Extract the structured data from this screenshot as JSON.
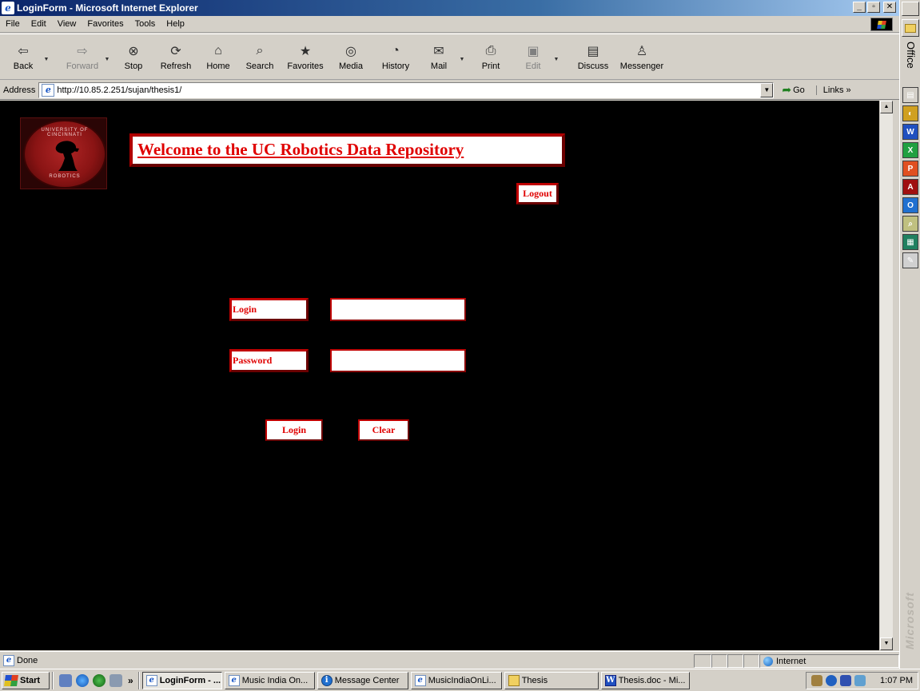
{
  "window": {
    "title": "LoginForm - Microsoft Internet Explorer",
    "controls": {
      "minimize": "_",
      "maximize": "▫",
      "close": "✕"
    }
  },
  "menu": [
    "File",
    "Edit",
    "View",
    "Favorites",
    "Tools",
    "Help"
  ],
  "toolbar": [
    {
      "label": "Back",
      "icon": "back-arrow-icon",
      "glyph": "⇦",
      "dropdown": true,
      "disabled": false
    },
    {
      "label": "Forward",
      "icon": "forward-arrow-icon",
      "glyph": "⇨",
      "dropdown": true,
      "disabled": true
    },
    {
      "label": "Stop",
      "icon": "stop-icon",
      "glyph": "⊗",
      "dropdown": false,
      "disabled": false
    },
    {
      "label": "Refresh",
      "icon": "refresh-icon",
      "glyph": "⟳",
      "dropdown": false,
      "disabled": false
    },
    {
      "label": "Home",
      "icon": "home-icon",
      "glyph": "⌂",
      "dropdown": false,
      "disabled": false
    },
    {
      "label": "Search",
      "icon": "search-icon",
      "glyph": "⌕",
      "dropdown": false,
      "disabled": false
    },
    {
      "label": "Favorites",
      "icon": "favorites-icon",
      "glyph": "★",
      "dropdown": false,
      "disabled": false
    },
    {
      "label": "Media",
      "icon": "media-icon",
      "glyph": "◎",
      "dropdown": false,
      "disabled": false
    },
    {
      "label": "History",
      "icon": "history-icon",
      "glyph": "◔",
      "dropdown": false,
      "disabled": false
    },
    {
      "label": "Mail",
      "icon": "mail-icon",
      "glyph": "✉",
      "dropdown": true,
      "disabled": false
    },
    {
      "label": "Print",
      "icon": "print-icon",
      "glyph": "⎙",
      "dropdown": false,
      "disabled": false
    },
    {
      "label": "Edit",
      "icon": "edit-icon",
      "glyph": "▣",
      "dropdown": true,
      "disabled": true
    },
    {
      "label": "Discuss",
      "icon": "discuss-icon",
      "glyph": "▤",
      "dropdown": false,
      "disabled": false
    },
    {
      "label": "Messenger",
      "icon": "messenger-icon",
      "glyph": "♙",
      "dropdown": false,
      "disabled": false
    }
  ],
  "address": {
    "label": "Address",
    "url": "http://10.85.2.251/sujan/thesis1/",
    "go_label": "Go",
    "links_label": "Links »"
  },
  "page": {
    "logo_text_top": "UNIVERSITY OF CINCINNATI",
    "logo_text_bottom": "ROBOTICS",
    "welcome": "Welcome to the UC Robotics Data Repository",
    "logout": "Logout",
    "login_label": "Login",
    "password_label": "Password",
    "login_value": "",
    "password_value": "",
    "login_button": "Login",
    "clear_button": "Clear"
  },
  "status": {
    "text": "Done",
    "zone": "Internet"
  },
  "taskbar": {
    "start": "Start",
    "chevron": "»",
    "tasks": [
      {
        "label": "LoginForm - ...",
        "icon": "ie",
        "active": true,
        "width": 100
      },
      {
        "label": "Music India On...",
        "icon": "ie",
        "active": false,
        "width": 113
      },
      {
        "label": "Message Center",
        "icon": "msg",
        "active": false,
        "width": 114
      },
      {
        "label": "MusicIndiaOnLi...",
        "icon": "ie",
        "active": false,
        "width": 114
      },
      {
        "label": "Thesis",
        "icon": "folder",
        "active": false,
        "width": 118
      },
      {
        "label": "Thesis.doc - Mi...",
        "icon": "word",
        "active": false,
        "width": 111
      }
    ],
    "clock": "1:07 PM"
  },
  "officebar": {
    "title": "Office",
    "watermark": "Microsoft",
    "apps": [
      {
        "name": "office-app-1",
        "color": "#d4d0c8",
        "glyph": "▤"
      },
      {
        "name": "office-app-2",
        "color": "#d0a020",
        "glyph": "◐"
      },
      {
        "name": "word-icon",
        "color": "#2050c0",
        "glyph": "W"
      },
      {
        "name": "excel-icon",
        "color": "#20a040",
        "glyph": "X"
      },
      {
        "name": "powerpoint-icon",
        "color": "#e05020",
        "glyph": "P"
      },
      {
        "name": "access-icon",
        "color": "#a01010",
        "glyph": "A"
      },
      {
        "name": "outlook-icon",
        "color": "#2070d0",
        "glyph": "O"
      },
      {
        "name": "find-icon",
        "color": "#c0c080",
        "glyph": "⌕"
      },
      {
        "name": "office-app-9",
        "color": "#208060",
        "glyph": "▦"
      },
      {
        "name": "office-app-10",
        "color": "#d0d0d0",
        "glyph": "✎"
      }
    ]
  }
}
